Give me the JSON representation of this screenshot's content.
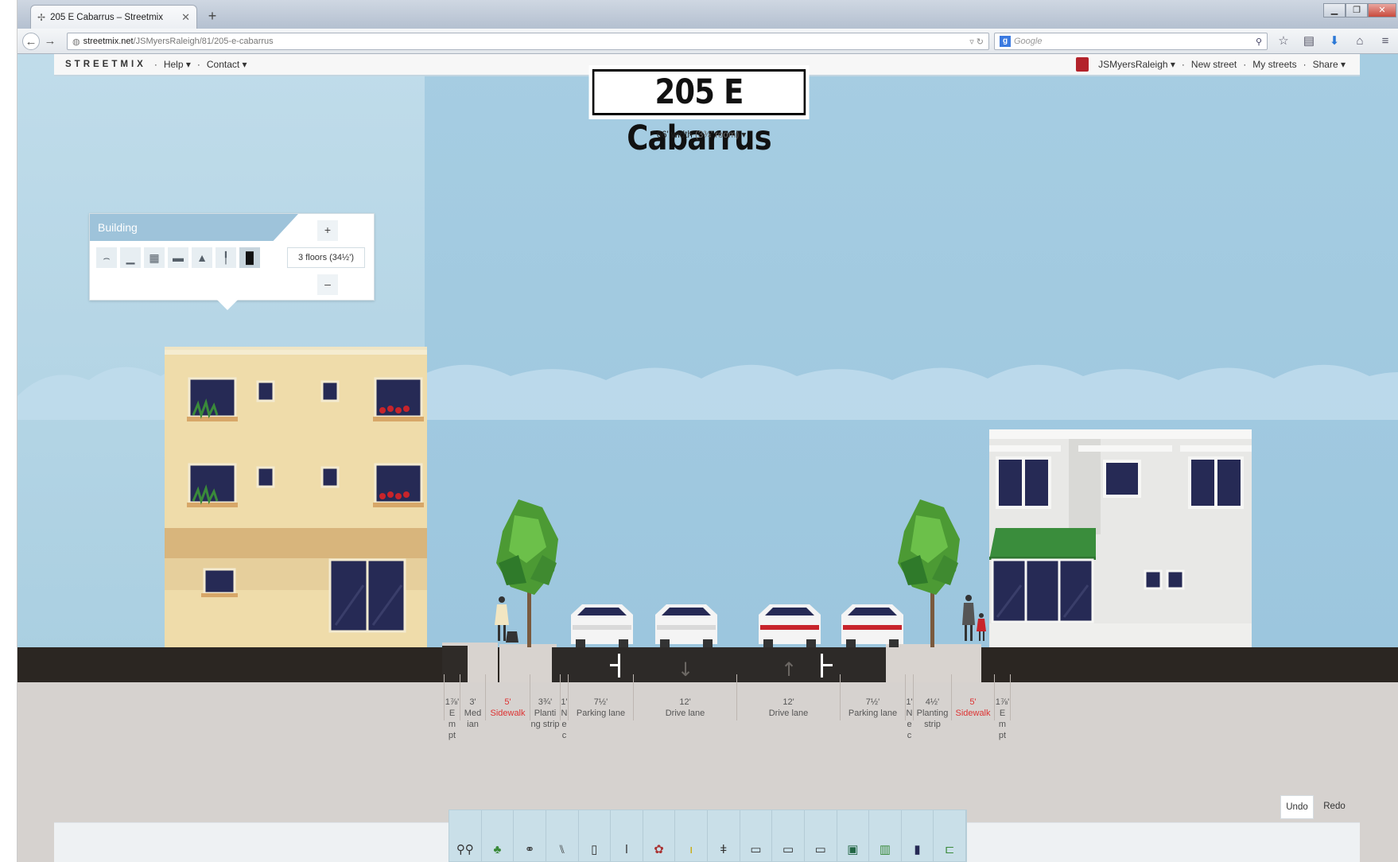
{
  "browser": {
    "tab_title": "205 E Cabarrus – Streetmix",
    "url_domain": "streetmix.net",
    "url_path": "/JSMyersRaleigh/81/205-e-cabarrus",
    "search_placeholder": "Google",
    "search_engine_glyph": "g"
  },
  "menu": {
    "logo": "STREETMIX",
    "help": "Help ▾",
    "contact": "Contact ▾",
    "user": "JSMyersRaleigh ▾",
    "new_street": "New street",
    "my_streets": "My streets",
    "share": "Share ▾",
    "dot": "·"
  },
  "street": {
    "name": "205 E Cabarrus",
    "width": "66' width",
    "room": "(3¾' room)",
    "width_arrow": "▾"
  },
  "building_popup": {
    "title": "Building",
    "plus": "+",
    "minus": "–",
    "floors": "3 floors (34½')",
    "icons": [
      "grass-icon",
      "fence-icon",
      "parking-lot-icon",
      "car-icon",
      "waterfront-icon",
      "fence-post-icon",
      "residential-icon"
    ],
    "selected_icon": 6
  },
  "segments": [
    {
      "width": "1⅞'",
      "name": "E m pt",
      "warn": false
    },
    {
      "width": "3'",
      "name": "Med ian",
      "warn": false
    },
    {
      "width": "5'",
      "name": "Sidewalk",
      "warn": true
    },
    {
      "width": "3¾'",
      "name": "Planti ng strip",
      "warn": false
    },
    {
      "width": "1'",
      "name": "N e c",
      "warn": false
    },
    {
      "width": "7½'",
      "name": "Parking lane",
      "warn": false
    },
    {
      "width": "12'",
      "name": "Drive lane",
      "warn": false
    },
    {
      "width": "12'",
      "name": "Drive lane",
      "warn": false
    },
    {
      "width": "7½'",
      "name": "Parking lane",
      "warn": false
    },
    {
      "width": "1'",
      "name": "N e c",
      "warn": false
    },
    {
      "width": "4½'",
      "name": "Planting strip",
      "warn": false
    },
    {
      "width": "5'",
      "name": "Sidewalk",
      "warn": true
    },
    {
      "width": "1⅞'",
      "name": "E m pt",
      "warn": false
    }
  ],
  "lane_arrows": [
    "↓",
    "↑"
  ],
  "undo": "Undo",
  "redo": "Redo",
  "palette": [
    "pedestrians-icon",
    "tree-icon",
    "bike-icon",
    "bench-icon",
    "kiosk-icon",
    "lamp-icon",
    "planter-icon",
    "hydrant-icon",
    "light-icon",
    "car-icon",
    "car-icon",
    "car-icon",
    "bus-icon",
    "streetcar-icon",
    "light-rail-icon",
    "transit-shelter-icon"
  ]
}
